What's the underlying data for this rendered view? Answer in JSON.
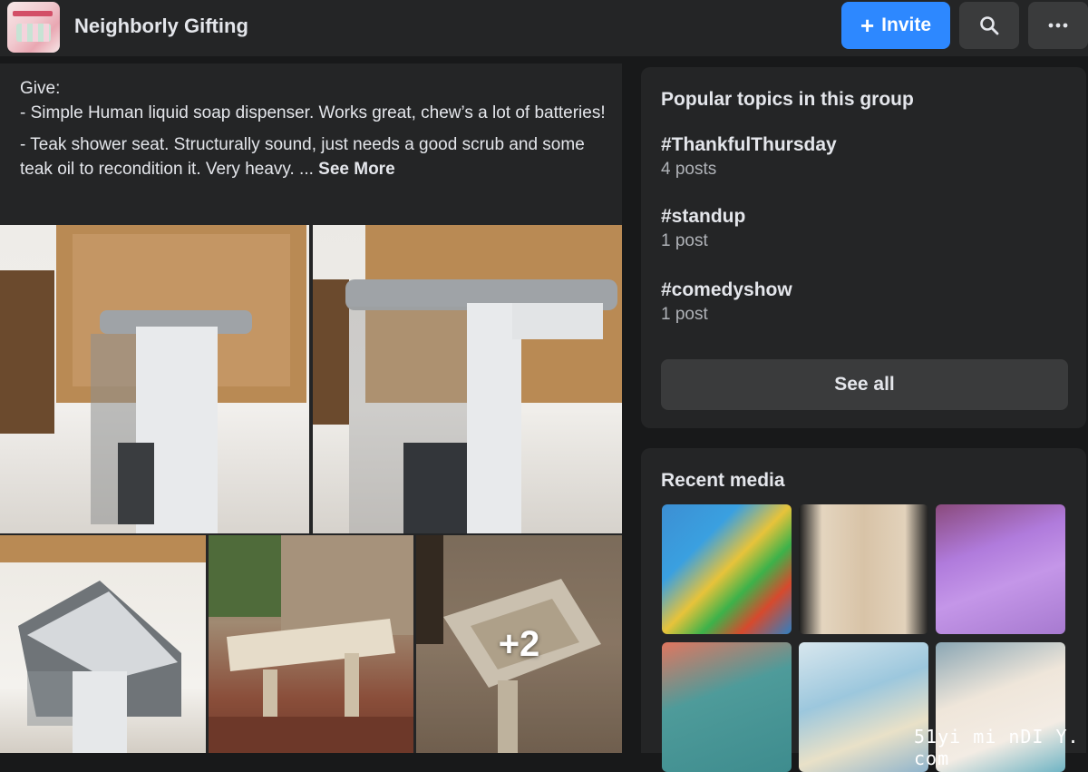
{
  "header": {
    "group_name": "Neighborly Gifting",
    "invite_label": "Invite",
    "invite_icon": "plus-icon",
    "search_icon": "search-icon",
    "more_icon": "more-icon",
    "accent_color": "#2d88ff"
  },
  "post": {
    "lines": [
      "Give:",
      "- Simple Human liquid soap dispenser. Works great, chew’s a lot of batteries!",
      "- Teak shower seat.  Structurally sound, just needs a good scrub and some teak oil to recondition it. Very heavy. ..."
    ],
    "see_more": "See More",
    "photos_more_overlay": "+2"
  },
  "topics": {
    "title": "Popular topics in this group",
    "items": [
      {
        "tag": "#ThankfulThursday",
        "count": "4 posts"
      },
      {
        "tag": "#standup",
        "count": "1 post"
      },
      {
        "tag": "#comedyshow",
        "count": "1 post"
      }
    ],
    "see_all": "See all"
  },
  "media": {
    "title": "Recent media"
  },
  "watermark": "51yi mi nDI Y. com"
}
